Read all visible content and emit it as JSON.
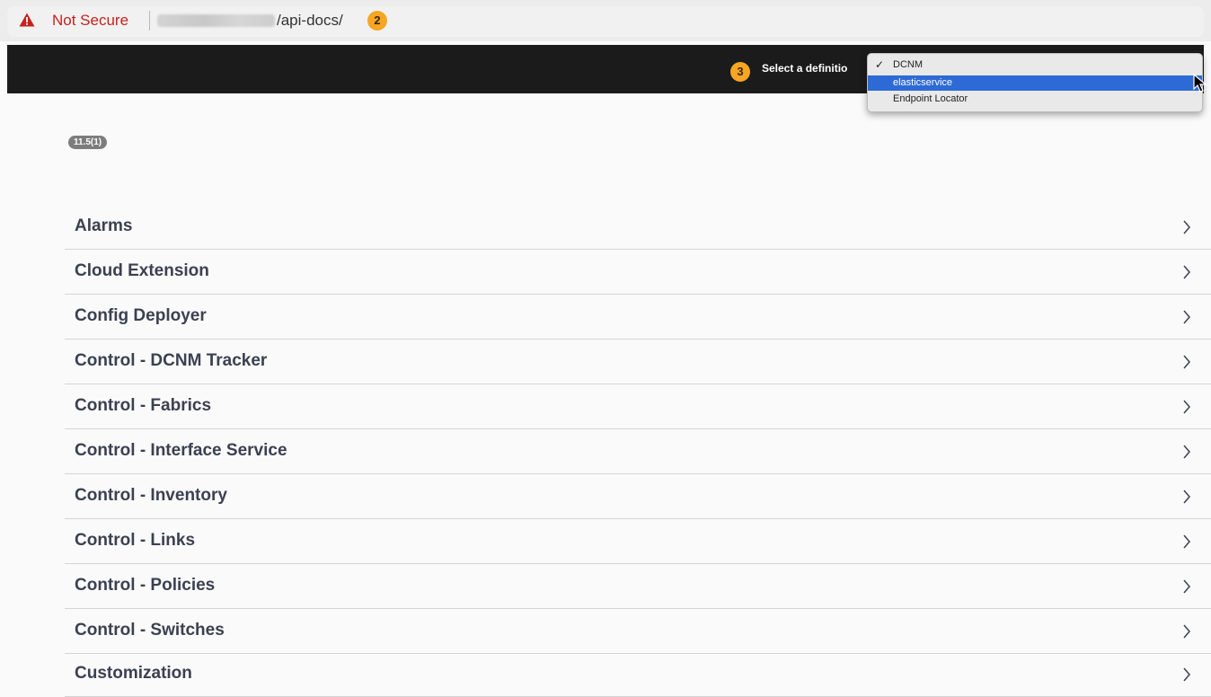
{
  "browser": {
    "security_label": "Not Secure",
    "path": "/api-docs/",
    "callout_address": "2"
  },
  "header": {
    "callout_select": "3",
    "select_label": "Select a definitio",
    "options": [
      {
        "label": "DCNM",
        "checked": true
      },
      {
        "label": "elasticservice",
        "highlighted": true
      },
      {
        "label": "Endpoint Locator"
      }
    ]
  },
  "version": "11.5(1)",
  "api_groups": [
    "Alarms",
    "Cloud Extension",
    "Config Deployer",
    "Control - DCNM Tracker",
    "Control - Fabrics",
    "Control - Interface Service",
    "Control - Inventory",
    "Control - Links",
    "Control - Policies",
    "Control - Switches",
    "Customization"
  ],
  "icons": {
    "warning": "warning-triangle-icon",
    "chevron": "chevron-right-icon",
    "check": "check-icon",
    "cursor": "mouse-cursor-icon"
  },
  "colors": {
    "warning": "#c5221f",
    "callout": "#f5a623",
    "header_bg": "#1b1b1b",
    "highlight": "#2e6ad6",
    "group_text": "#3b4151"
  }
}
